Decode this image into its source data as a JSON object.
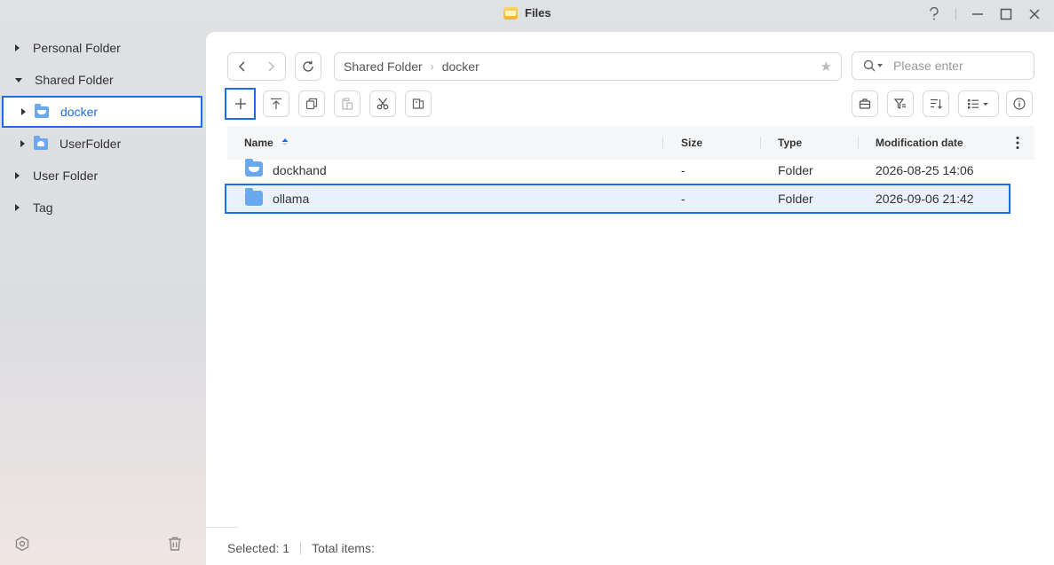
{
  "window": {
    "title": "Files",
    "help_icon": "question-icon",
    "controls": [
      "minimize-icon",
      "maximize-icon",
      "close-icon"
    ]
  },
  "sidebar": {
    "items": [
      {
        "label": "Personal Folder",
        "expanded": false
      },
      {
        "label": "Shared Folder",
        "expanded": true
      },
      {
        "label": "docker",
        "selected": true,
        "icon": "docker-folder-icon"
      },
      {
        "label": "UserFolder",
        "icon": "user-folder-icon"
      },
      {
        "label": "User Folder",
        "expanded": false
      },
      {
        "label": "Tag",
        "expanded": false
      }
    ],
    "bottom_icons": [
      "settings-icon",
      "trash-icon"
    ]
  },
  "toolbar": {
    "path": [
      "Shared Folder",
      "docker"
    ],
    "search_placeholder": "Please enter",
    "left_icons": [
      "add-icon",
      "upload-icon",
      "copy-icon",
      "paste-icon",
      "cut-icon",
      "move-icon"
    ],
    "right_icons": [
      "briefcase-icon",
      "filter-icon",
      "sort-icon",
      "view-list-icon",
      "info-icon"
    ]
  },
  "table": {
    "columns": {
      "name": "Name",
      "size": "Size",
      "type": "Type",
      "modified": "Modification date"
    },
    "sort": {
      "column": "Name",
      "direction": "ascending"
    },
    "rows": [
      {
        "name": "dockhand",
        "size": "-",
        "type": "Folder",
        "modified": "2026-08-25 14:06",
        "selected": false
      },
      {
        "name": "ollama",
        "size": "-",
        "type": "Folder",
        "modified": "2026-09-06 21:42",
        "selected": true
      }
    ]
  },
  "footer": {
    "selected": "Selected: 1",
    "total": "Total items:"
  },
  "colors": {
    "accent": "#1a6ee8",
    "folder": "#6aa8f0",
    "selected_row_bg": "#e9f1fd"
  }
}
